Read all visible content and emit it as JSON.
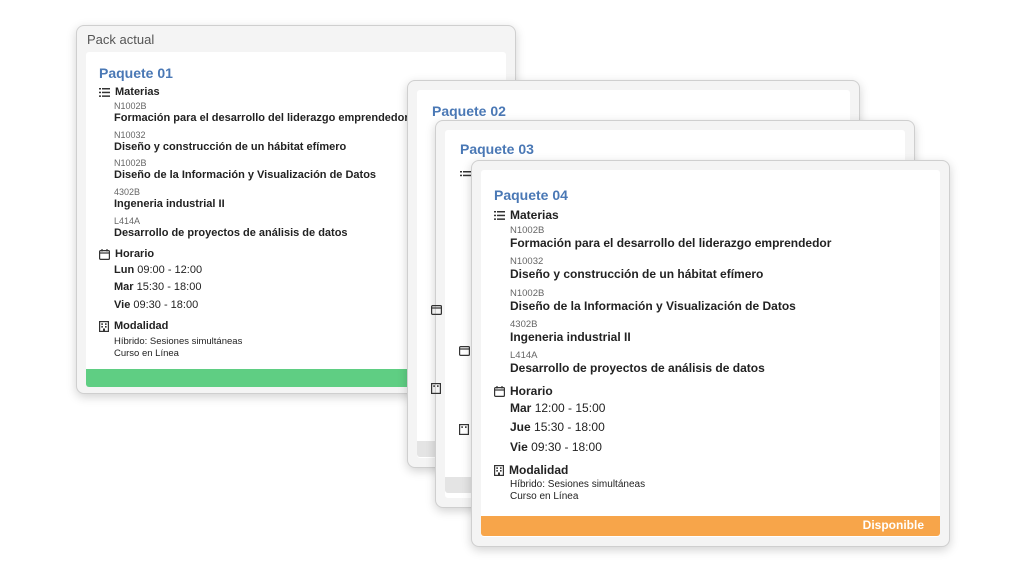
{
  "card1": {
    "frame_title": "Pack actual",
    "title": "Paquete 01",
    "materias_label": "Materias",
    "subjects": [
      {
        "code": "N1002B",
        "name": "Formación para el desarrollo del liderazgo emprendedor"
      },
      {
        "code": "N10032",
        "name": "Diseño y construcción de un hábitat efímero"
      },
      {
        "code": "N1002B",
        "name": "Diseño de la Información y Visualización de Datos"
      },
      {
        "code": "4302B",
        "name": "Ingeneria industrial II"
      },
      {
        "code": "L414A",
        "name": "Desarrollo de proyectos de análisis de datos"
      }
    ],
    "horario_label": "Horario",
    "schedule": [
      {
        "day": "Lun",
        "time": "09:00 - 12:00"
      },
      {
        "day": "Mar",
        "time": "15:30 - 18:00"
      },
      {
        "day": "Vie",
        "time": "09:30 - 18:00"
      }
    ],
    "modalidad_label": "Modalidad",
    "modalidad": [
      "Híbrido: Sesiones simultáneas",
      "Curso en Línea"
    ],
    "status_color": "#5fce83"
  },
  "card2": {
    "title": "Paquete 02"
  },
  "card3": {
    "title": "Paquete 03"
  },
  "card4": {
    "title": "Paquete 04",
    "materias_label": "Materias",
    "subjects": [
      {
        "code": "N1002B",
        "name": "Formación para el desarrollo del liderazgo emprendedor"
      },
      {
        "code": "N10032",
        "name": "Diseño y construcción de un hábitat efímero"
      },
      {
        "code": "N1002B",
        "name": "Diseño de la Información y Visualización de Datos"
      },
      {
        "code": "4302B",
        "name": "Ingeneria industrial II"
      },
      {
        "code": "L414A",
        "name": "Desarrollo de proyectos de análisis de datos"
      }
    ],
    "horario_label": "Horario",
    "schedule": [
      {
        "day": "Mar",
        "time": "12:00 - 15:00"
      },
      {
        "day": "Jue",
        "time": "15:30 - 18:00"
      },
      {
        "day": "Vie",
        "time": "09:30 - 18:00"
      }
    ],
    "modalidad_label": "Modalidad",
    "modalidad": [
      "Híbrido: Sesiones simultáneas",
      "Curso en Línea"
    ],
    "status": "Disponible",
    "status_color": "#f7a54a"
  },
  "colors": {
    "accent": "#4a78b5"
  },
  "icons": {
    "materias": "list-icon",
    "horario": "calendar-icon",
    "modalidad": "building-icon"
  }
}
